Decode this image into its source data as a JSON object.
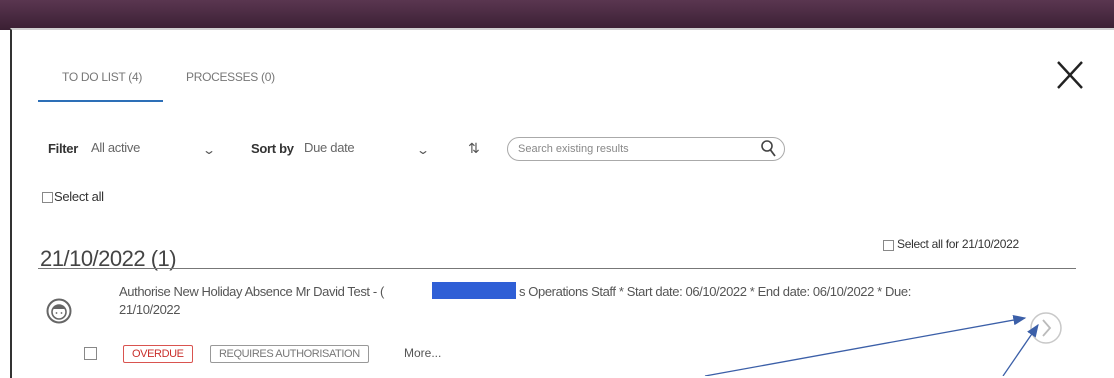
{
  "tabs": [
    {
      "label": "TO DO LIST (4)"
    },
    {
      "label": "PROCESSES (0)"
    }
  ],
  "filter": {
    "label": "Filter",
    "value": "All active"
  },
  "sort": {
    "label": "Sort by",
    "value": "Due date"
  },
  "search": {
    "placeholder": "Search existing results"
  },
  "select_all": {
    "label": "Select all"
  },
  "group": {
    "heading": "21/10/2022 (1)",
    "select_all_label": "Select all for 21/10/2022"
  },
  "task": {
    "line1_left": "Authorise New Holiday Absence Mr David Test - (",
    "line1_right": "s Operations Staff * Start date: 06/10/2022 * End date: 06/10/2022 * Due:",
    "line2": "21/10/2022",
    "badges": [
      "OVERDUE",
      "REQUIRES AUTHORISATION"
    ],
    "more_label": "More..."
  },
  "icons": {
    "close": "close-icon",
    "search": "search-icon",
    "sort": "sort-direction-icon",
    "avatar": "avatar-icon",
    "open": "chevron-right-icon"
  },
  "colors": {
    "accent": "#2d6fb7",
    "overdue": "#d9534f",
    "redaction": "#2f5fd6",
    "annotation_arrow": "#3b5fa8"
  }
}
